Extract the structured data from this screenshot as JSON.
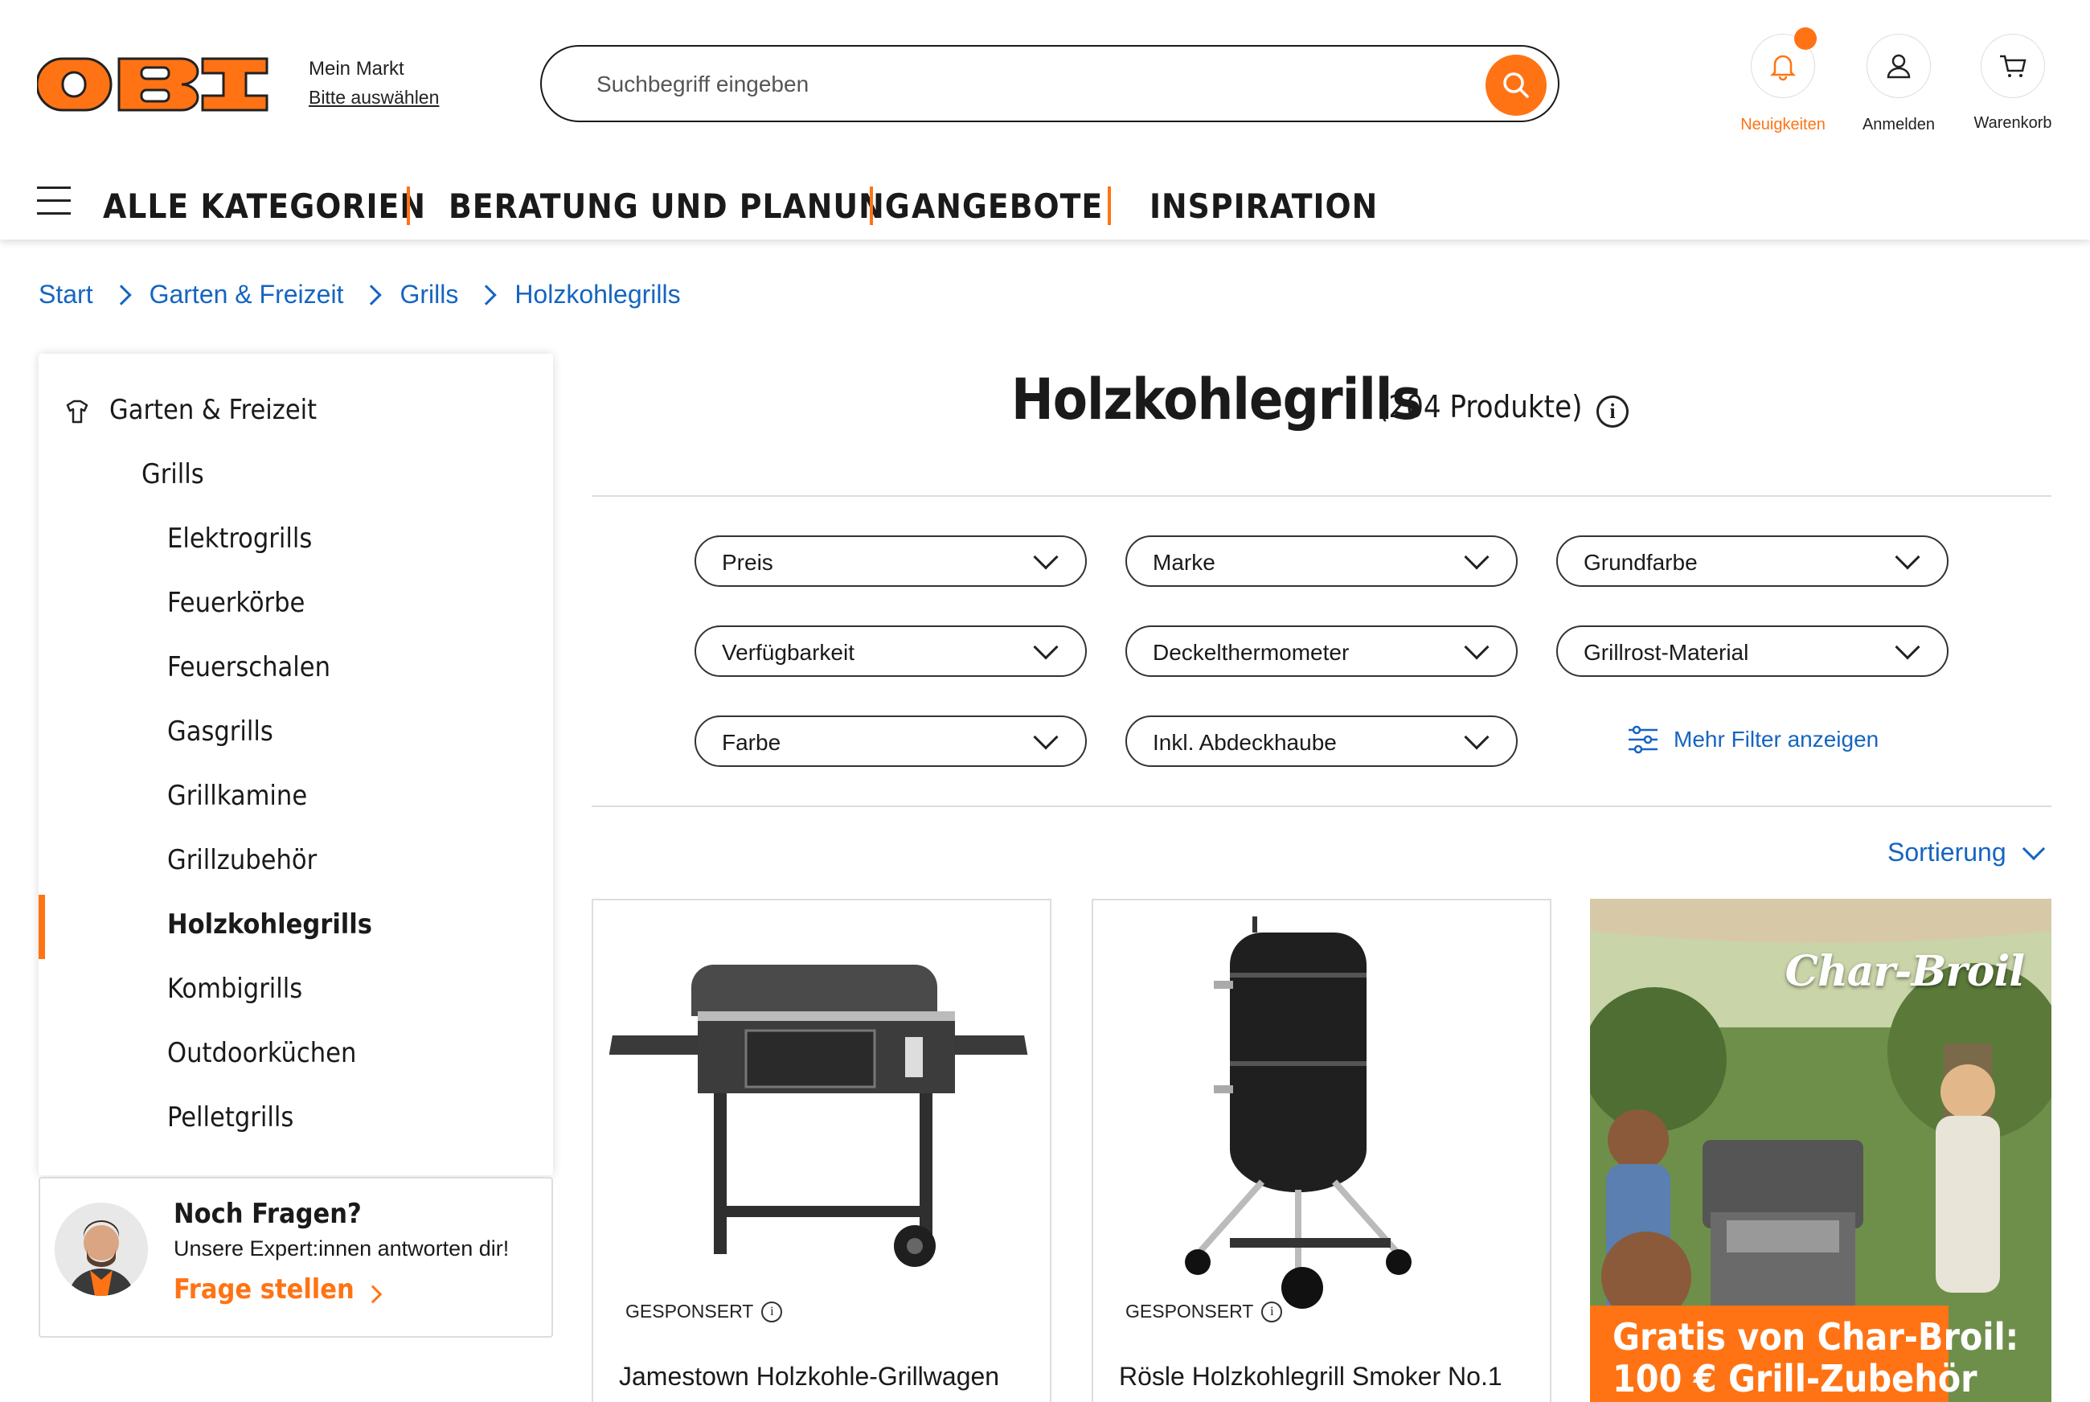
{
  "header": {
    "logo_text": "OBI",
    "market_label": "Mein Markt",
    "market_select": "Bitte auswählen",
    "search_placeholder": "Suchbegriff eingeben",
    "actions": [
      {
        "label": "Neuigkeiten",
        "icon": "bell-icon",
        "color": "#ff7314"
      },
      {
        "label": "Anmelden",
        "icon": "user-icon"
      },
      {
        "label": "Warenkorb",
        "icon": "cart-icon"
      }
    ]
  },
  "nav": {
    "items": [
      "ALLE KATEGORIEN",
      "BERATUNG UND PLANUNG",
      "ANGEBOTE",
      "INSPIRATION"
    ]
  },
  "breadcrumb": [
    "Start",
    "Garten & Freizeit",
    "Grills",
    "Holzkohlegrills"
  ],
  "sidebar": {
    "root": "Garten & Freizeit",
    "parent": "Grills",
    "items": [
      "Elektrogrills",
      "Feuerkörbe",
      "Feuerschalen",
      "Gasgrills",
      "Grillkamine",
      "Grillzubehör",
      "Holzkohlegrills",
      "Kombigrills",
      "Outdoorküchen",
      "Pelletgrills"
    ],
    "active": "Holzkohlegrills"
  },
  "help": {
    "title": "Noch Fragen?",
    "text": "Unsere Expert:innen antworten dir!",
    "link": "Frage stellen"
  },
  "main": {
    "title": "Holzkohlegrills",
    "count": "(204 Produkte)",
    "filters": [
      "Preis",
      "Marke",
      "Grundfarbe",
      "Verfügbarkeit",
      "Deckelthermometer",
      "Grillrost-Material",
      "Farbe",
      "Inkl. Abdeckhaube"
    ],
    "more_filters": "Mehr Filter anzeigen",
    "sort": "Sortierung",
    "products": [
      {
        "name": "Jamestown Holzkohle-Grillwagen",
        "badge": "GESPONSERT"
      },
      {
        "name": "Rösle Holzkohlegrill Smoker No.1",
        "badge": "GESPONSERT"
      }
    ],
    "promo": {
      "brand": "Char-Broil",
      "line1": "Gratis von Char-Broil:",
      "line2": "100 € Grill-Zubehör"
    }
  },
  "colors": {
    "accent": "#ff7314",
    "link": "#1565c0"
  }
}
